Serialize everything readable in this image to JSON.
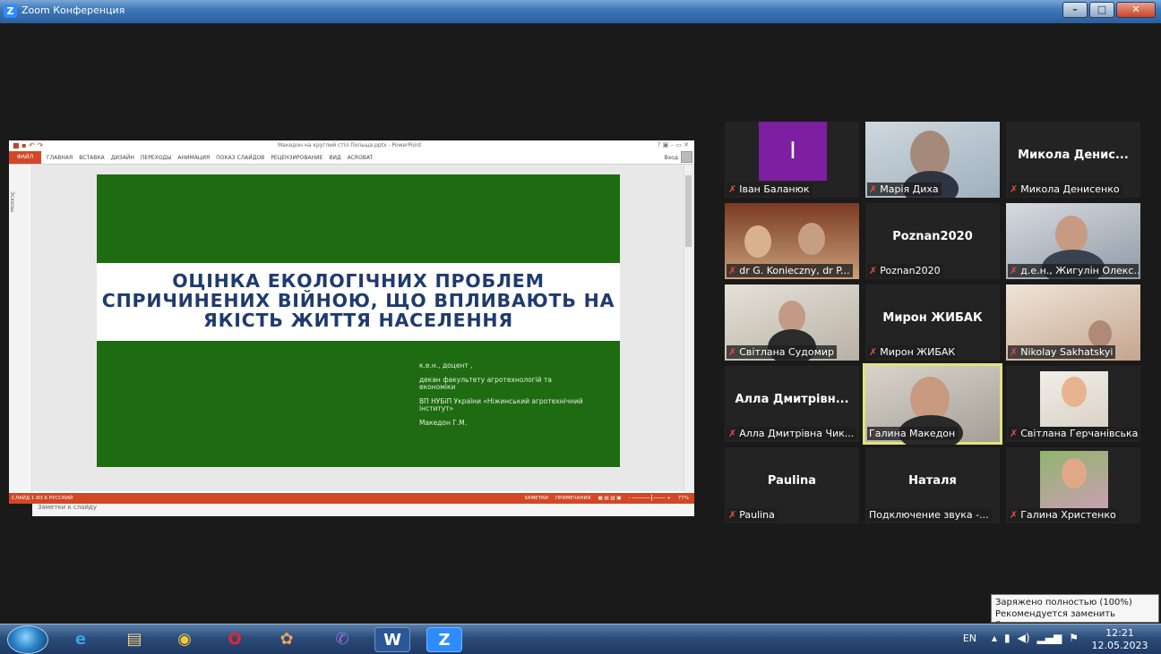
{
  "window": {
    "title": "Zoom Конференция",
    "controls": [
      "–",
      "□",
      "✕"
    ]
  },
  "powerpoint": {
    "window_title": "Македон на круглий стіл Польща.pptx - PowerPoint",
    "file_tab": "ФАЙЛ",
    "tabs": [
      "ГЛАВНАЯ",
      "ВСТАВКА",
      "ДИЗАЙН",
      "ПЕРЕХОДЫ",
      "АНИМАЦИЯ",
      "ПОКАЗ СЛАЙДОВ",
      "РЕЦЕНЗИРОВАНИЕ",
      "ВИД",
      "ACROBAT"
    ],
    "signin": "Вход",
    "thumbnails_label": "Эскизы",
    "notes_placeholder": "Заметки к слайду",
    "status_left": "СЛАЙД 1 ИЗ 6    РУССКИЙ",
    "status_notes": "ЗАМЕТКИ",
    "status_comments": "ПРИМЕЧАНИЯ",
    "zoom_level": "77%",
    "slide": {
      "title": "ОЦІНКА ЕКОЛОГІЧНИХ ПРОБЛЕМ СПРИЧИНЕНИХ ВІЙНОЮ, ЩО ВПЛИВАЮТЬ НА ЯКІСТЬ ЖИТТЯ НАСЕЛЕННЯ",
      "info": [
        "к.е.н., доцент ,",
        "декан факультету агротехнологій та економіки",
        "ВП НУБіП України «Ніжинський агротехнічний інститут»",
        "Македон Г.М."
      ]
    }
  },
  "participants": [
    {
      "name": "Іван Баланюк",
      "display": "I",
      "muted": true
    },
    {
      "name": "Марія Диха",
      "display": "",
      "muted": true
    },
    {
      "name": "Микола Денисенко",
      "display": "Микола Денис...",
      "muted": true
    },
    {
      "name": "dr G. Konieczny, dr P...",
      "display": "",
      "muted": true
    },
    {
      "name": "Poznan2020",
      "display": "Poznan2020",
      "muted": true
    },
    {
      "name": "д.е.н., Жигулін Олекс...",
      "display": "",
      "muted": true
    },
    {
      "name": "Світлана Судомир",
      "display": "",
      "muted": true
    },
    {
      "name": "Мирон ЖИБАК",
      "display": "Мирон ЖИБАК",
      "muted": true
    },
    {
      "name": "Nikolay Sakhatskyi",
      "display": "",
      "muted": true
    },
    {
      "name": "Алла Дмитрівна Чик...",
      "display": "Алла Дмитрівн...",
      "muted": true
    },
    {
      "name": "Галина Македон",
      "display": "",
      "muted": false
    },
    {
      "name": "Світлана Герчанівська",
      "display": "",
      "muted": true
    },
    {
      "name": "Paulina",
      "display": "Paulina",
      "muted": true
    },
    {
      "name": "Подключение звука -...",
      "display": "Наталя",
      "muted": false
    },
    {
      "name": "Галина Христенко",
      "display": "",
      "muted": true
    }
  ],
  "taskbar": {
    "apps": [
      "internet-explorer",
      "file-explorer",
      "chrome",
      "opera",
      "tool",
      "viber",
      "word",
      "zoom"
    ],
    "lang": "EN",
    "time": "12:21",
    "date": "12.05.2023"
  },
  "tooltip": {
    "line1": "Заряжено полностью (100%)",
    "line2": "Рекомендуется заменить батарею."
  },
  "colors": {
    "slide_green": "#1e6b12",
    "slide_title": "#1f3b6e",
    "pp_accent": "#d24726",
    "active_speaker": "#e4e27a",
    "muted_icon": "#e24b4b"
  }
}
